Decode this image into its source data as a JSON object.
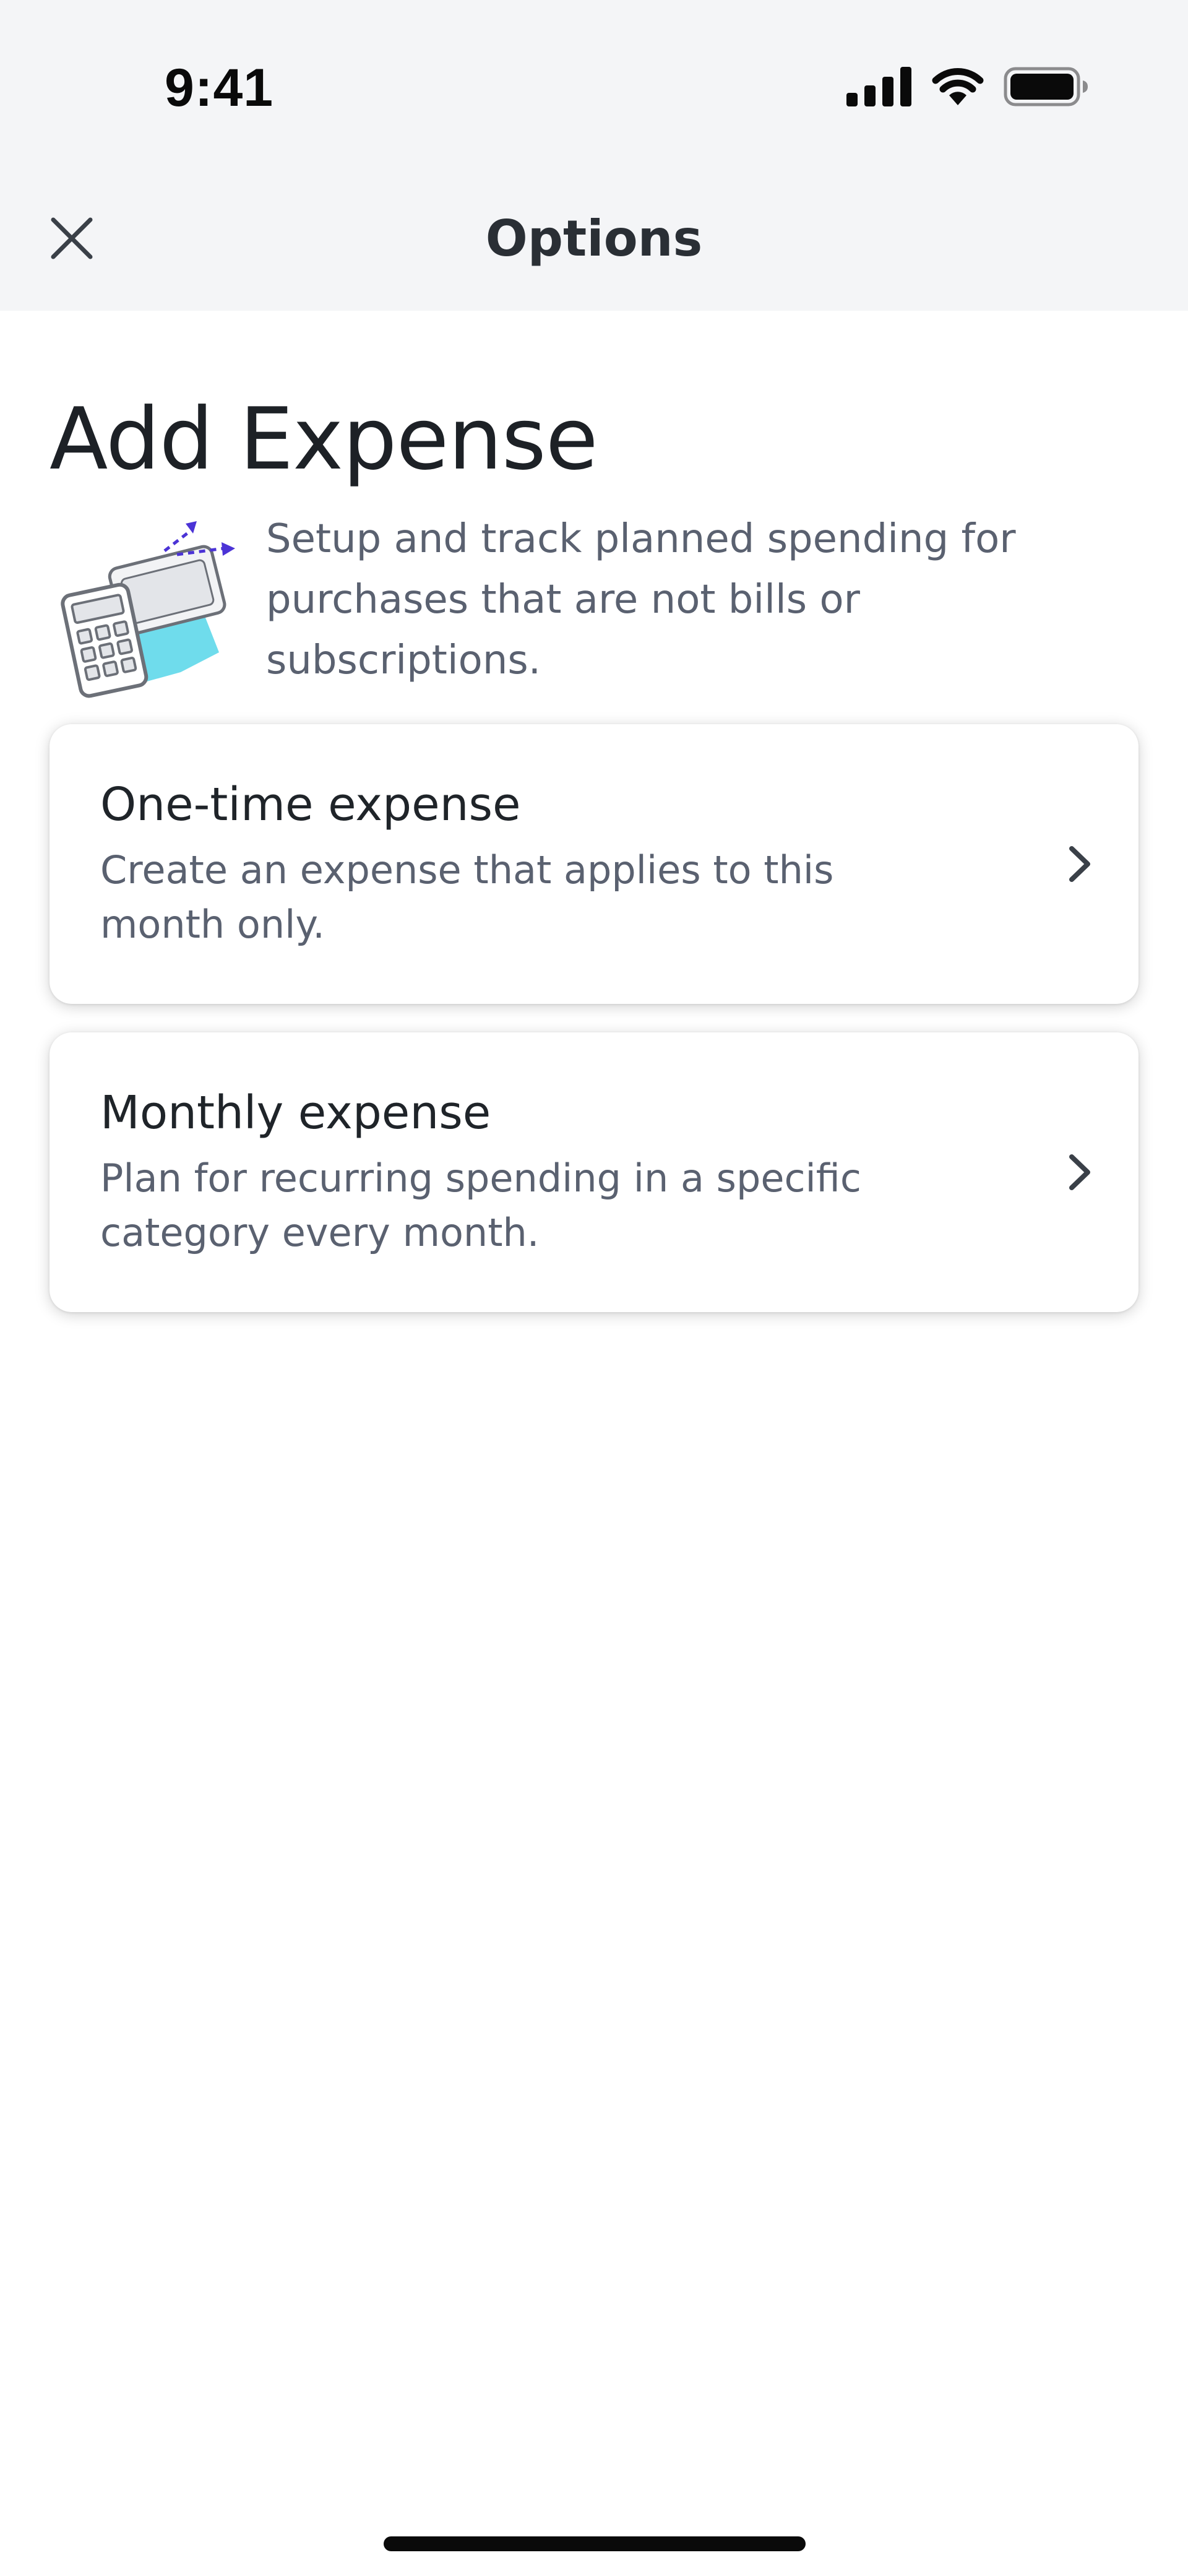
{
  "status_bar": {
    "time": "9:41"
  },
  "nav": {
    "title": "Options",
    "close_icon": "close-icon"
  },
  "page": {
    "title": "Add Expense",
    "description": "Setup and track planned spending for purchases that are not bills or subscriptions.",
    "illustration": "calculator-wallet-illustration"
  },
  "options": [
    {
      "title": "One-time expense",
      "description": "Create an expense that applies to this month only.",
      "icon": "chevron-right-icon"
    },
    {
      "title": "Monthly expense",
      "description": "Plan for recurring spending in a specific category every month.",
      "icon": "chevron-right-icon"
    }
  ],
  "colors": {
    "header_background": "#f4f5f7",
    "illustration_accent_cyan": "#6fdcec",
    "illustration_accent_purple": "#4b33d6",
    "secondary_text": "#5a6170"
  }
}
